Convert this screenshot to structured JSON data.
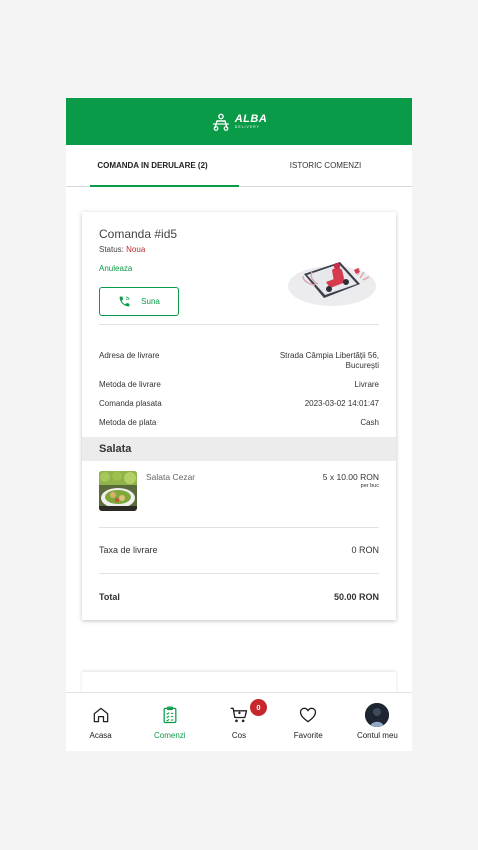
{
  "header": {
    "brand": "ALBA",
    "brand_sub": "DELIVERY"
  },
  "tabs": [
    {
      "label": "COMANDA IN DERULARE  (2)",
      "active": true
    },
    {
      "label": "ISTORIC COMENZI",
      "active": false
    }
  ],
  "order": {
    "title": "Comanda #id5",
    "status_label": "Status:",
    "status_value": "Noua",
    "cancel_label": "Anuleaza",
    "call_label": "Suna",
    "details": [
      {
        "label": "Adresa de livrare",
        "value": "Strada Câmpia Libertății 56,",
        "value2": "București"
      },
      {
        "label": "Metoda de livrare",
        "value": "Livrare"
      },
      {
        "label": "Comanda plasata",
        "value": "2023-03-02 14:01:47"
      },
      {
        "label": "Metoda de plata",
        "value": "Cash"
      }
    ],
    "section_title": "Salata",
    "product": {
      "name": "Salata Cezar",
      "qty_price": "5 x 10.00 RON",
      "unit": "per buc"
    },
    "delivery_fee_label": "Taxa de livrare",
    "delivery_fee_value": "0 RON",
    "total_label": "Total",
    "total_value": "50.00 RON"
  },
  "nav": {
    "home": "Acasa",
    "orders": "Comenzi",
    "cart": "Cos",
    "cart_count": "0",
    "favorites": "Favorite",
    "account": "Contul meu"
  },
  "colors": {
    "brand_green": "#0a9b48",
    "status_red": "#c0262c",
    "badge_red": "#c6262c"
  }
}
